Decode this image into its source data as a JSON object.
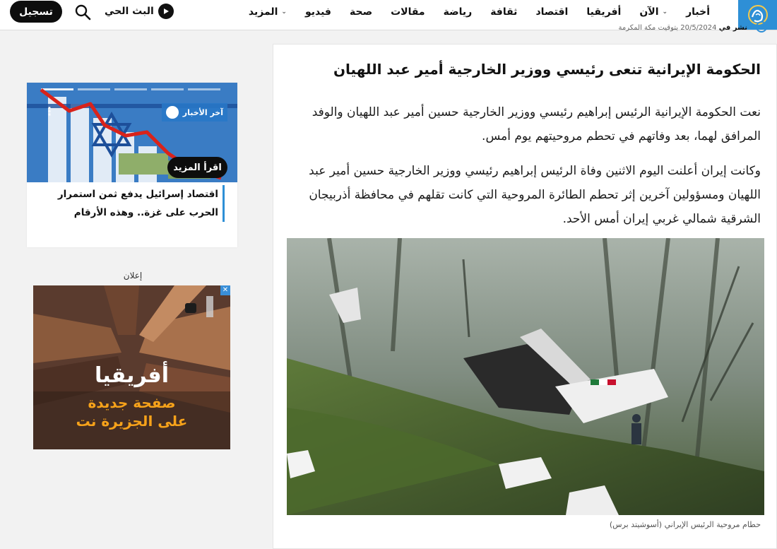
{
  "nav": {
    "items": [
      {
        "label": "أخبار"
      },
      {
        "label": "الآن",
        "dropdown": true
      },
      {
        "label": "أفريقيا"
      },
      {
        "label": "اقتصاد"
      },
      {
        "label": "ثقافة"
      },
      {
        "label": "رياضة"
      },
      {
        "label": "مقالات"
      },
      {
        "label": "صحة"
      },
      {
        "label": "فيديو"
      },
      {
        "label": "المزيد",
        "dropdown": true
      }
    ],
    "live_label": "البث الحي",
    "signup_label": "تسجيل",
    "brand_color": "#2e8fd6"
  },
  "ticker": {
    "bold": "نشر في",
    "text": "20/5/2024 بتوقيت مكة المكرمة"
  },
  "article": {
    "headline": "الحكومة الإيرانية تنعى رئيسي ووزير الخارجية أمير عبد اللهيان",
    "paragraphs": [
      "نعت الحكومة الإيرانية الرئيس إبراهيم رئيسي ووزير الخارجية حسين أمير عبد اللهيان والوفد المرافق لهما، بعد وفاتهم في تحطم مروحيتهم يوم أمس.",
      "وكانت إيران أعلنت اليوم الاثنين وفاة الرئيس إبراهيم رئيسي ووزير الخارجية حسين أمير عبد اللهيان ومسؤولين آخرين إثر تحطم الطائرة المروحية التي كانت تقلهم في محافظة أذربيجان الشرقية شمالي غربي إيران أمس الأحد."
    ],
    "caption": "حطام مروحية الرئيس الإيراني (أسوشيتد برس)"
  },
  "promo": {
    "tag": "آخر الأخبار",
    "read_more": "اقرأ المزيد",
    "title": "اقتصاد إسرائيل يدفع ثمن استمرار الحرب على غزة.. وهذه الأرقام"
  },
  "ad": {
    "label": "إعلان",
    "line1": "أفريقيا",
    "line2": "صفحة جديدة",
    "line3": "على الجزيرة نت",
    "close": "✕"
  }
}
